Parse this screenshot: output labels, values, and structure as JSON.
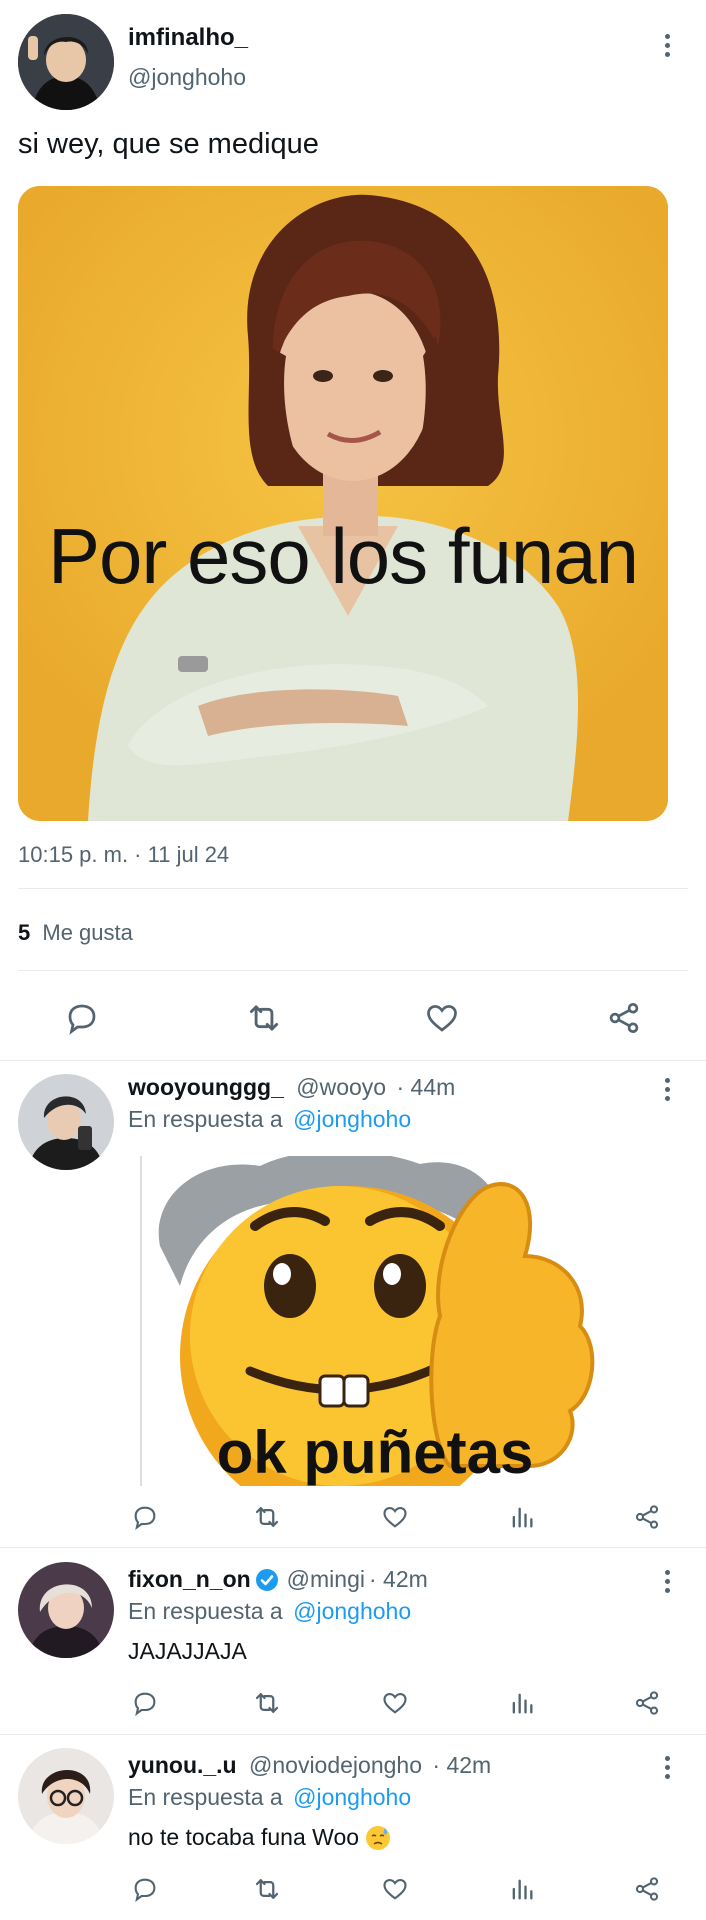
{
  "main_tweet": {
    "display_name": "imfinalho_",
    "handle": "@jonghoho",
    "text": "si wey, que se medique",
    "image_caption": "Por eso los funan",
    "timestamp": "10:15 p. m. · 11 jul 24",
    "likes_count": "5",
    "likes_label": "Me gusta",
    "actions": [
      "reply-icon",
      "retweet-icon",
      "like-icon",
      "share-icon"
    ]
  },
  "replies": [
    {
      "display_name": "wooyounggg_",
      "handle": "@wooyo",
      "time": "· 44m",
      "reply_prefix": "En respuesta a",
      "reply_to": "@jonghoho",
      "text": "",
      "image_caption": "ok puñetas",
      "verified": false
    },
    {
      "display_name": "fixon_n_on",
      "handle": "@mingi",
      "time": "· 42m",
      "reply_prefix": "En respuesta a",
      "reply_to": "@jonghoho",
      "text": "JAJAJJAJA",
      "verified": true
    },
    {
      "display_name": "yunou._.u",
      "handle": "@noviodejongho",
      "time": "· 42m",
      "reply_prefix": "En respuesta a",
      "reply_to": "@jonghoho",
      "text": "no te tocaba funa Woo",
      "emoji": "😓",
      "verified": false
    }
  ],
  "colors": {
    "accent": "#1d9bf0",
    "muted": "#536471",
    "divider": "#e6ecf0",
    "meme_bg": "#f0b93a"
  }
}
